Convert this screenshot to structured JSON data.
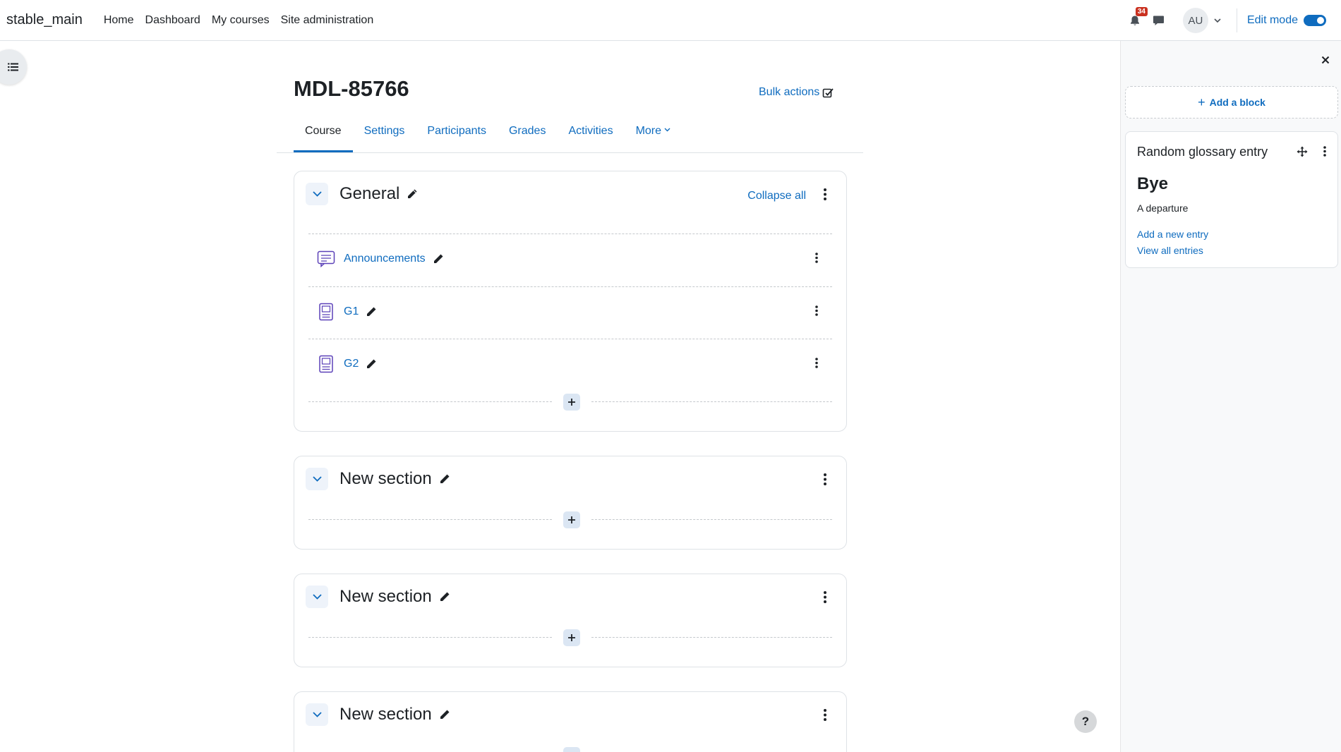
{
  "site": {
    "name": "stable_main"
  },
  "nav": {
    "items": [
      {
        "label": "Home"
      },
      {
        "label": "Dashboard"
      },
      {
        "label": "My courses"
      },
      {
        "label": "Site administration"
      }
    ],
    "notification_count": "34",
    "avatar_initials": "AU",
    "edit_mode_label": "Edit mode",
    "edit_mode_on": true
  },
  "course": {
    "title": "MDL-85766",
    "bulk_actions": "Bulk actions",
    "tabs": [
      {
        "label": "Course",
        "active": true
      },
      {
        "label": "Settings"
      },
      {
        "label": "Participants"
      },
      {
        "label": "Grades"
      },
      {
        "label": "Activities"
      },
      {
        "label": "More"
      }
    ],
    "collapse_all": "Collapse all",
    "sections": [
      {
        "title": "General",
        "activities": [
          {
            "name": "Announcements",
            "icon": "forum-icon"
          },
          {
            "name": "G1",
            "icon": "glossary-icon"
          },
          {
            "name": "G2",
            "icon": "glossary-icon"
          }
        ]
      },
      {
        "title": "New section"
      },
      {
        "title": "New section"
      },
      {
        "title": "New section"
      }
    ]
  },
  "blocks": {
    "add_block": "Add a block",
    "glossary": {
      "title": "Random glossary entry",
      "concept": "Bye",
      "definition": "A departure",
      "add_entry": "Add a new entry",
      "view_all": "View all entries"
    }
  },
  "help_label": "?",
  "colors": {
    "accent": "#0f6cbf",
    "badge": "#ca3120",
    "activity_icon": "#5b40b8"
  }
}
